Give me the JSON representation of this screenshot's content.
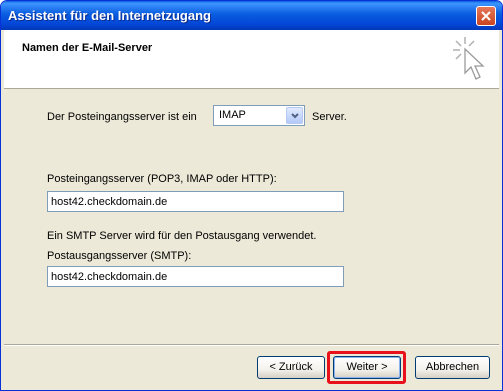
{
  "window": {
    "title": "Assistent für den Internetzugang"
  },
  "header": {
    "title": "Namen der E-Mail-Server"
  },
  "form": {
    "incoming_type_label": "Der Posteingangsserver ist ein",
    "incoming_type_value": "IMAP",
    "incoming_type_suffix": "Server.",
    "incoming_server_label": "Posteingangsserver (POP3, IMAP oder HTTP):",
    "incoming_server_value": "host42.checkdomain.de",
    "smtp_note": "Ein SMTP Server wird für den Postausgang verwendet.",
    "outgoing_server_label": "Postausgangsserver (SMTP):",
    "outgoing_server_value": "host42.checkdomain.de"
  },
  "buttons": {
    "back": "< Zurück",
    "next": "Weiter >",
    "cancel": "Abbrechen"
  },
  "colors": {
    "titlebar": "#0a5de0",
    "highlight": "#e8101a",
    "dialog_bg": "#ece9d8"
  }
}
